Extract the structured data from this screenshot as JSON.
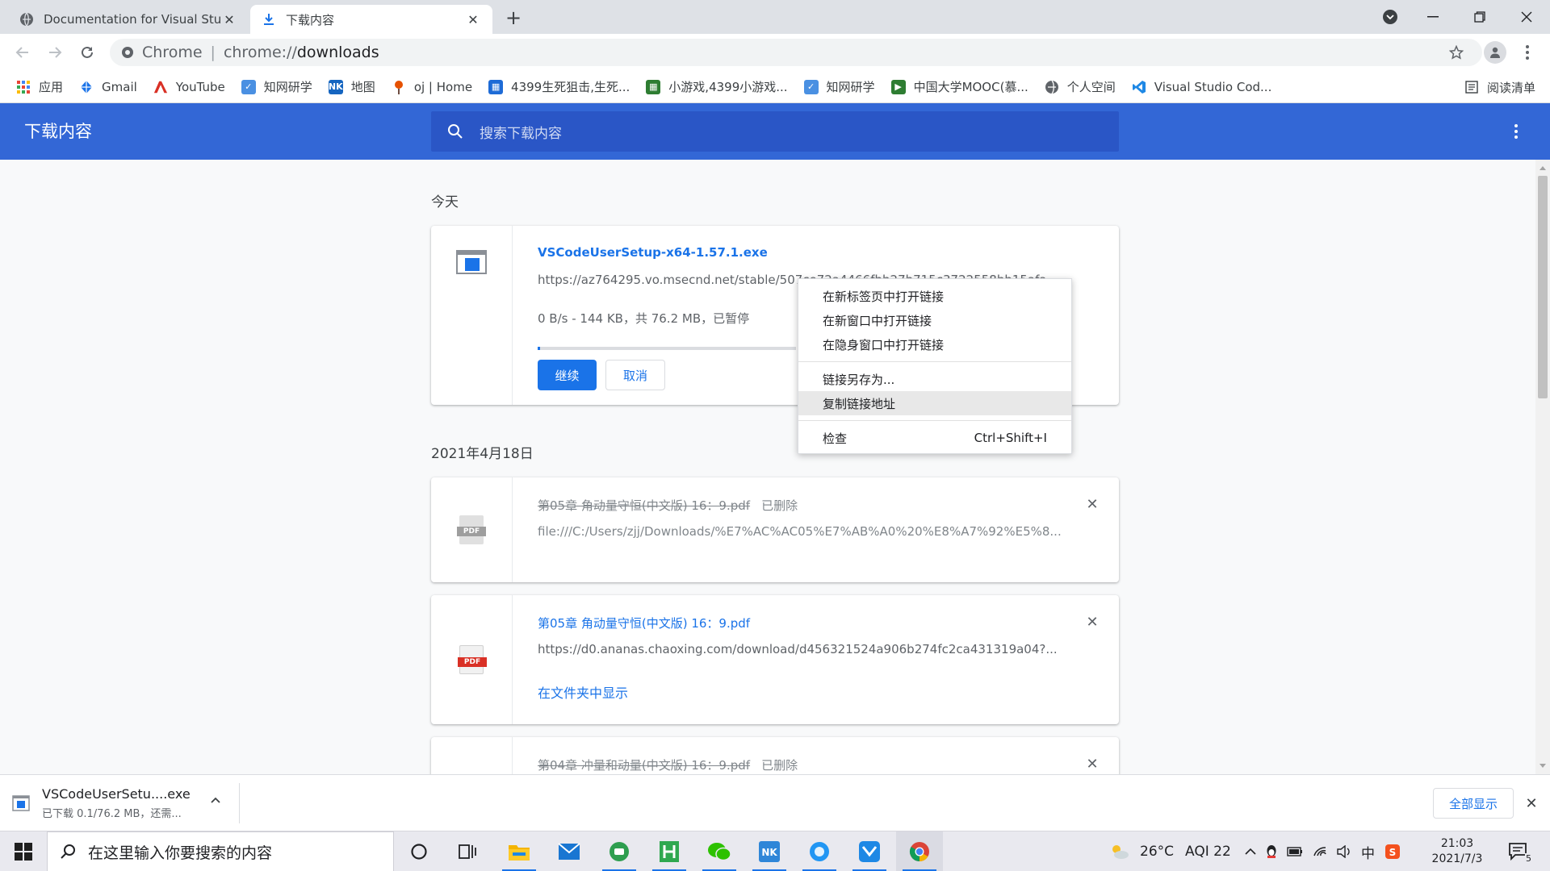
{
  "browser": {
    "tabs": [
      {
        "title": "Documentation for Visual Studio Code",
        "favicon": "globe-icon",
        "active": false
      },
      {
        "title": "下载内容",
        "favicon": "download-icon",
        "active": true
      }
    ],
    "omnibox": {
      "chip": "Chrome",
      "separator": "|",
      "url_scheme": "chrome://",
      "url_host": "downloads"
    },
    "bookmarks": [
      {
        "label": "应用",
        "icon": "apps-grid-icon"
      },
      {
        "label": "Gmail",
        "icon": "gmail-icon"
      },
      {
        "label": "YouTube",
        "icon": "youtube-icon"
      },
      {
        "label": "知网研学",
        "icon": "cnki-icon"
      },
      {
        "label": "地图",
        "icon": "map-icon"
      },
      {
        "label": "oj | Home",
        "icon": "oj-icon"
      },
      {
        "label": "4399生死狙击,生死...",
        "icon": "game-icon"
      },
      {
        "label": "小游戏,4399小游戏...",
        "icon": "game-grid-icon"
      },
      {
        "label": "知网研学",
        "icon": "cnki-icon"
      },
      {
        "label": "中国大学MOOC(慕...",
        "icon": "mooc-icon"
      },
      {
        "label": "个人空间",
        "icon": "globe-icon"
      },
      {
        "label": "Visual Studio Cod...",
        "icon": "vscode-icon"
      }
    ],
    "reading_list": "阅读清单"
  },
  "downloads_page": {
    "title": "下载内容",
    "search_placeholder": "搜索下载内容",
    "groups": [
      {
        "date": "今天",
        "items": [
          {
            "filename": "VSCodeUserSetup-x64-1.57.1.exe",
            "url": "https://az764295.vo.msecnd.net/stable/507ce72a4466fbb27b715c3722558bb15afa...",
            "status": "0 B/s - 144 KB，共 76.2 MB，已暂停",
            "progress": 0.0019,
            "resume_label": "继续",
            "cancel_label": "取消"
          }
        ]
      },
      {
        "date": "2021年4月18日",
        "items": [
          {
            "filename": "第05章 角动量守恒(中文版) 16：9.pdf",
            "deleted_label": "已删除",
            "url": "file:///C:/Users/zjj/Downloads/%E7%AC%AC05%E7%AB%A0%20%E8%A7%92%E5%8..."
          },
          {
            "filename": "第05章 角动量守恒(中文版) 16：9.pdf",
            "url": "https://d0.ananas.chaoxing.com/download/d456321524a906b274fc2ca431319a04?...",
            "show_in_folder": "在文件夹中显示"
          },
          {
            "filename": "第04章 冲量和动量(中文版) 16：9.pdf",
            "deleted_label": "已删除"
          }
        ]
      }
    ]
  },
  "context_menu": {
    "items": [
      {
        "label": "在新标签页中打开链接"
      },
      {
        "label": "在新窗口中打开链接"
      },
      {
        "label": "在隐身窗口中打开链接"
      },
      {
        "label": "链接另存为..."
      },
      {
        "label": "复制链接地址",
        "highlighted": true
      },
      {
        "label": "检查",
        "shortcut": "Ctrl+Shift+I"
      }
    ]
  },
  "download_shelf": {
    "item_name": "VSCodeUserSetu....exe",
    "item_status": "已下载 0.1/76.2 MB，还需...",
    "show_all": "全部显示"
  },
  "taskbar": {
    "search_placeholder": "在这里输入你要搜索的内容",
    "weather": "26°C",
    "aqi": "AQI 22",
    "ime": "中",
    "time": "21:03",
    "date": "2021/7/3",
    "notification_count": "5"
  },
  "colors": {
    "header_blue": "#3367d6",
    "search_blue": "#2a56c6",
    "link_blue": "#1a73e8",
    "pdf_red": "#d93025"
  }
}
